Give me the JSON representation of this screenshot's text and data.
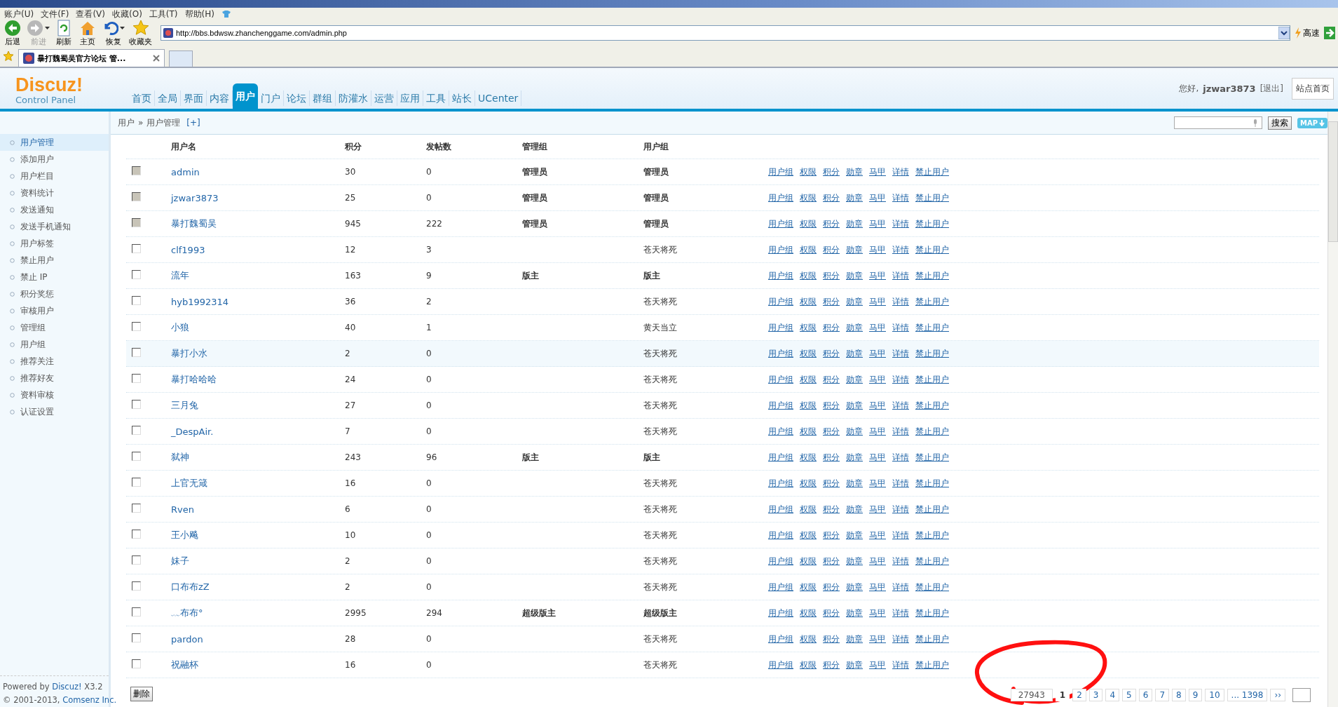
{
  "browser": {
    "menu": [
      "账户(U)",
      "文件(F)",
      "查看(V)",
      "收藏(O)",
      "工具(T)",
      "帮助(H)"
    ],
    "toolbar": [
      {
        "label": "后退",
        "kind": "back",
        "disabled": false,
        "dropdown": false
      },
      {
        "label": "前进",
        "kind": "forward",
        "disabled": true,
        "dropdown": true
      },
      {
        "label": "刷新",
        "kind": "refresh",
        "disabled": false,
        "dropdown": false
      },
      {
        "label": "主页",
        "kind": "home",
        "disabled": false,
        "dropdown": false
      },
      {
        "label": "恢复",
        "kind": "restore",
        "disabled": false,
        "dropdown": true
      },
      {
        "label": "收藏夹",
        "kind": "favorites",
        "disabled": false,
        "dropdown": false
      }
    ],
    "address": "http://bbs.bdwsw.zhanchenggame.com/admin.php",
    "speed_label": "高速",
    "tabs": [
      {
        "label": "暴打魏蜀吴官方论坛 管...",
        "selected": true
      }
    ]
  },
  "header": {
    "logo": "Discuz!",
    "logo_sub": "Control Panel",
    "nav": [
      {
        "label": "首页",
        "selected": false
      },
      {
        "label": "全局",
        "selected": false
      },
      {
        "label": "界面",
        "selected": false
      },
      {
        "label": "内容",
        "selected": false
      },
      {
        "label": "用户",
        "selected": true
      },
      {
        "label": "门户",
        "selected": false
      },
      {
        "label": "论坛",
        "selected": false
      },
      {
        "label": "群组",
        "selected": false
      },
      {
        "label": "防灌水",
        "selected": false
      },
      {
        "label": "运营",
        "selected": false
      },
      {
        "label": "应用",
        "selected": false
      },
      {
        "label": "工具",
        "selected": false
      },
      {
        "label": "站长",
        "selected": false
      },
      {
        "label": "UCenter",
        "selected": false
      }
    ],
    "greeting": "您好,",
    "user": "jzwar3873",
    "logout": "[退出]",
    "site_home": "站点首页"
  },
  "breadcrumb": {
    "items": [
      "用户",
      "用户管理"
    ],
    "separator": "»",
    "add": "[+]"
  },
  "search": {
    "button": "搜索",
    "map": "MAP"
  },
  "sidebar": {
    "items": [
      {
        "label": "用户管理",
        "selected": true
      },
      {
        "label": "添加用户",
        "selected": false
      },
      {
        "label": "用户栏目",
        "selected": false
      },
      {
        "label": "资料统计",
        "selected": false
      },
      {
        "label": "发送通知",
        "selected": false
      },
      {
        "label": "发送手机通知",
        "selected": false
      },
      {
        "label": "用户标签",
        "selected": false
      },
      {
        "label": "禁止用户",
        "selected": false
      },
      {
        "label": "禁止 IP",
        "selected": false
      },
      {
        "label": "积分奖惩",
        "selected": false
      },
      {
        "label": "审核用户",
        "selected": false
      },
      {
        "label": "管理组",
        "selected": false
      },
      {
        "label": "用户组",
        "selected": false
      },
      {
        "label": "推荐关注",
        "selected": false
      },
      {
        "label": "推荐好友",
        "selected": false
      },
      {
        "label": "资料审核",
        "selected": false
      },
      {
        "label": "认证设置",
        "selected": false
      }
    ],
    "powered": {
      "prefix": "Powered by",
      "link": "Discuz!",
      "suffix": "X3.2"
    },
    "copyright": {
      "prefix": "© 2001-2013,",
      "link": "Comsenz Inc."
    }
  },
  "table": {
    "columns": [
      "用户名",
      "积分",
      "发帖数",
      "管理组",
      "用户组"
    ],
    "rows": [
      {
        "username": "admin",
        "credits": "30",
        "posts": "0",
        "admin_group": "管理员",
        "user_group": "管理员",
        "staff": true,
        "disabled": true,
        "highlighted": false,
        "actions": [
          "用户组",
          "权限",
          "积分",
          "勋章",
          "马甲",
          "详情",
          "禁止用户"
        ]
      },
      {
        "username": "jzwar3873",
        "credits": "25",
        "posts": "0",
        "admin_group": "管理员",
        "user_group": "管理员",
        "staff": true,
        "disabled": true,
        "highlighted": false,
        "actions": [
          "用户组",
          "权限",
          "积分",
          "勋章",
          "马甲",
          "详情",
          "禁止用户"
        ]
      },
      {
        "username": "暴打魏蜀吴",
        "credits": "945",
        "posts": "222",
        "admin_group": "管理员",
        "user_group": "管理员",
        "staff": true,
        "disabled": true,
        "highlighted": false,
        "actions": [
          "用户组",
          "权限",
          "积分",
          "勋章",
          "马甲",
          "详情",
          "禁止用户"
        ]
      },
      {
        "username": "clf1993",
        "credits": "12",
        "posts": "3",
        "user_group": "苍天将死",
        "staff": false,
        "disabled": false,
        "highlighted": false,
        "actions": [
          "用户组",
          "权限",
          "积分",
          "勋章",
          "马甲",
          "详情",
          "禁止用户"
        ]
      },
      {
        "username": "流年",
        "credits": "163",
        "posts": "9",
        "admin_group": "版主",
        "user_group": "版主",
        "staff": true,
        "disabled": false,
        "highlighted": false,
        "actions": [
          "用户组",
          "权限",
          "积分",
          "勋章",
          "马甲",
          "详情",
          "禁止用户"
        ]
      },
      {
        "username": "hyb1992314",
        "credits": "36",
        "posts": "2",
        "user_group": "苍天将死",
        "staff": false,
        "disabled": false,
        "highlighted": false,
        "actions": [
          "用户组",
          "权限",
          "积分",
          "勋章",
          "马甲",
          "详情",
          "禁止用户"
        ]
      },
      {
        "username": "小狼",
        "credits": "40",
        "posts": "1",
        "user_group": "黄天当立",
        "staff": false,
        "disabled": false,
        "highlighted": false,
        "actions": [
          "用户组",
          "权限",
          "积分",
          "勋章",
          "马甲",
          "详情",
          "禁止用户"
        ]
      },
      {
        "username": "暴打小水",
        "credits": "2",
        "posts": "0",
        "user_group": "苍天将死",
        "staff": false,
        "disabled": false,
        "highlighted": true,
        "actions": [
          "用户组",
          "权限",
          "积分",
          "勋章",
          "马甲",
          "详情",
          "禁止用户"
        ]
      },
      {
        "username": "暴打哈哈哈",
        "credits": "24",
        "posts": "0",
        "user_group": "苍天将死",
        "staff": false,
        "disabled": false,
        "highlighted": false,
        "actions": [
          "用户组",
          "权限",
          "积分",
          "勋章",
          "马甲",
          "详情",
          "禁止用户"
        ]
      },
      {
        "username": "三月兔",
        "credits": "27",
        "posts": "0",
        "user_group": "苍天将死",
        "staff": false,
        "disabled": false,
        "highlighted": false,
        "actions": [
          "用户组",
          "权限",
          "积分",
          "勋章",
          "马甲",
          "详情",
          "禁止用户"
        ]
      },
      {
        "username": "_DespAir.",
        "credits": "7",
        "posts": "0",
        "user_group": "苍天将死",
        "staff": false,
        "disabled": false,
        "highlighted": false,
        "actions": [
          "用户组",
          "权限",
          "积分",
          "勋章",
          "马甲",
          "详情",
          "禁止用户"
        ]
      },
      {
        "username": "弑神",
        "credits": "243",
        "posts": "96",
        "admin_group": "版主",
        "user_group": "版主",
        "staff": true,
        "disabled": false,
        "highlighted": false,
        "actions": [
          "用户组",
          "权限",
          "积分",
          "勋章",
          "马甲",
          "详情",
          "禁止用户"
        ]
      },
      {
        "username": "上官无箴",
        "credits": "16",
        "posts": "0",
        "user_group": "苍天将死",
        "staff": false,
        "disabled": false,
        "highlighted": false,
        "actions": [
          "用户组",
          "权限",
          "积分",
          "勋章",
          "马甲",
          "详情",
          "禁止用户"
        ]
      },
      {
        "username": "Rven",
        "credits": "6",
        "posts": "0",
        "user_group": "苍天将死",
        "staff": false,
        "disabled": false,
        "highlighted": false,
        "actions": [
          "用户组",
          "权限",
          "积分",
          "勋章",
          "马甲",
          "详情",
          "禁止用户"
        ]
      },
      {
        "username": "王小飚",
        "credits": "10",
        "posts": "0",
        "user_group": "苍天将死",
        "staff": false,
        "disabled": false,
        "highlighted": false,
        "actions": [
          "用户组",
          "权限",
          "积分",
          "勋章",
          "马甲",
          "详情",
          "禁止用户"
        ]
      },
      {
        "username": "妹子",
        "credits": "2",
        "posts": "0",
        "user_group": "苍天将死",
        "staff": false,
        "disabled": false,
        "highlighted": false,
        "actions": [
          "用户组",
          "权限",
          "积分",
          "勋章",
          "马甲",
          "详情",
          "禁止用户"
        ]
      },
      {
        "username": "口布布zZ",
        "credits": "2",
        "posts": "0",
        "user_group": "苍天将死",
        "staff": false,
        "disabled": false,
        "highlighted": false,
        "actions": [
          "用户组",
          "权限",
          "积分",
          "勋章",
          "马甲",
          "详情",
          "禁止用户"
        ]
      },
      {
        "username": "﹏布布°",
        "credits": "2995",
        "posts": "294",
        "admin_group": "超级版主",
        "user_group": "超级版主",
        "staff": true,
        "disabled": false,
        "highlighted": false,
        "actions": [
          "用户组",
          "权限",
          "积分",
          "勋章",
          "马甲",
          "详情",
          "禁止用户"
        ]
      },
      {
        "username": "pardon",
        "credits": "28",
        "posts": "0",
        "user_group": "苍天将死",
        "staff": false,
        "disabled": false,
        "highlighted": false,
        "actions": [
          "用户组",
          "权限",
          "积分",
          "勋章",
          "马甲",
          "详情",
          "禁止用户"
        ]
      },
      {
        "username": "祝融杯",
        "credits": "16",
        "posts": "0",
        "user_group": "苍天将死",
        "staff": false,
        "disabled": false,
        "highlighted": false,
        "actions": [
          "用户组",
          "权限",
          "积分",
          "勋章",
          "马甲",
          "详情",
          "禁止用户"
        ]
      }
    ]
  },
  "delete_button": "删除",
  "pagination": {
    "total": "27943",
    "pages": [
      {
        "label": "1",
        "selected": true
      },
      {
        "label": "2",
        "selected": false
      },
      {
        "label": "3",
        "selected": false
      },
      {
        "label": "4",
        "selected": false
      },
      {
        "label": "5",
        "selected": false
      },
      {
        "label": "6",
        "selected": false
      },
      {
        "label": "7",
        "selected": false
      },
      {
        "label": "8",
        "selected": false
      },
      {
        "label": "9",
        "selected": false
      },
      {
        "label": "10",
        "selected": false
      },
      {
        "label": "... 1398",
        "selected": false
      }
    ],
    "next": "››"
  }
}
